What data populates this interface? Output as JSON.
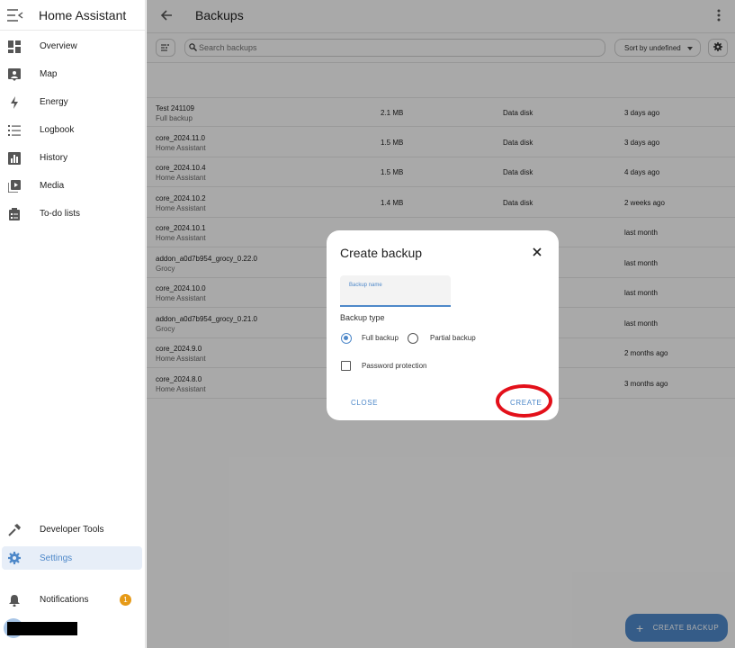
{
  "app": {
    "title": "Home Assistant"
  },
  "sidebar": {
    "items": [
      {
        "label": "Overview",
        "icon": "dashboard-icon"
      },
      {
        "label": "Map",
        "icon": "map-icon"
      },
      {
        "label": "Energy",
        "icon": "lightning-icon"
      },
      {
        "label": "Logbook",
        "icon": "list-icon"
      },
      {
        "label": "History",
        "icon": "chart-icon"
      },
      {
        "label": "Media",
        "icon": "media-icon"
      },
      {
        "label": "To-do lists",
        "icon": "clipboard-icon"
      }
    ],
    "bottom": [
      {
        "label": "Developer Tools",
        "icon": "hammer-icon"
      },
      {
        "label": "Settings",
        "icon": "gear-icon",
        "active": true
      },
      {
        "label": "Notifications",
        "icon": "bell-icon",
        "badge": "1"
      }
    ]
  },
  "header": {
    "title": "Backups"
  },
  "search": {
    "placeholder": "Search backups"
  },
  "sort": {
    "label": "Sort by undefined"
  },
  "backups": [
    {
      "name": "Test 241109",
      "type": "Full backup",
      "size": "2.1 MB",
      "location": "Data disk",
      "date": "3 days ago"
    },
    {
      "name": "core_2024.11.0",
      "type": "Home Assistant",
      "size": "1.5 MB",
      "location": "Data disk",
      "date": "3 days ago"
    },
    {
      "name": "core_2024.10.4",
      "type": "Home Assistant",
      "size": "1.5 MB",
      "location": "Data disk",
      "date": "4 days ago"
    },
    {
      "name": "core_2024.10.2",
      "type": "Home Assistant",
      "size": "1.4 MB",
      "location": "Data disk",
      "date": "2 weeks ago"
    },
    {
      "name": "core_2024.10.1",
      "type": "Home Assistant",
      "size": "",
      "location": "",
      "date": "last month"
    },
    {
      "name": "addon_a0d7b954_grocy_0.22.0",
      "type": "Grocy",
      "size": "",
      "location": "",
      "date": "last month"
    },
    {
      "name": "core_2024.10.0",
      "type": "Home Assistant",
      "size": "",
      "location": "",
      "date": "last month"
    },
    {
      "name": "addon_a0d7b954_grocy_0.21.0",
      "type": "Grocy",
      "size": "",
      "location": "",
      "date": "last month"
    },
    {
      "name": "core_2024.9.0",
      "type": "Home Assistant",
      "size": "",
      "location": "",
      "date": "2 months ago"
    },
    {
      "name": "core_2024.8.0",
      "type": "Home Assistant",
      "size": "",
      "location": "",
      "date": "3 months ago"
    }
  ],
  "fab": {
    "label": "CREATE BACKUP"
  },
  "dialog": {
    "title": "Create backup",
    "name_field_label": "Backup name",
    "name_field_value": "",
    "backup_type_label": "Backup type",
    "options": {
      "full": "Full backup",
      "partial": "Partial backup"
    },
    "selected_option": "full",
    "password_label": "Password protection",
    "password_checked": false,
    "close_label": "CLOSE",
    "create_label": "CREATE"
  },
  "colors": {
    "accent": "#4e88c9",
    "badge": "#e69a17",
    "highlight": "#e3101a"
  }
}
